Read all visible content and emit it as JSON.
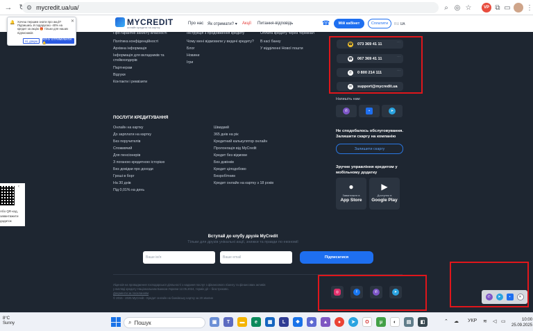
{
  "browser": {
    "url": "mycredit.ua/ua/"
  },
  "header": {
    "logo_name": "MYCREDIT",
    "logo_tagline": "онлайн кредити на картку",
    "nav": [
      "Про нас",
      "Як отримати? ▾",
      "Акції",
      "Питання-відповідь"
    ],
    "cabinet_button": "Мій кабінет",
    "pay_button": "Сплатити",
    "lang_ru": "RU",
    "lang_ua": "UA"
  },
  "popup": {
    "text": "Хочеш першим знати про акції? Підпишись й подаруємо -40% на кредит за акцію 🎁 тільки для наших підписників",
    "no_button": "Ні, дякую",
    "yes_button": "ХОЧУ ОТРИМУВАТИ 🔔"
  },
  "footer": {
    "col1": [
      "Про гарантію захисту власності",
      "Політика конфіденційності",
      "Архівна інформація",
      "Інформація для вкладників та стейкхолдерів",
      "Партнерам",
      "Відгуки",
      "Контакти і реквізити"
    ],
    "col2": [
      "Інструкція з продовження кредиту",
      "Чому мені відмовили у видачі кредиту?",
      "Блог",
      "Новини",
      "Ігри"
    ],
    "col3": [
      "Оплата кредиту через термінал",
      "В касі банку",
      "У відділенні Нової пошти"
    ],
    "services_title": "ПОСЛУГИ КРЕДИТУВАННЯ",
    "services_col1": [
      "Онлайн на картку",
      "До зарплати на картку",
      "Без поручителів",
      "Споживчий",
      "Для пенсіонерів",
      "З поганою кредитною історією",
      "Без довідки про доходи",
      "Гроші в борг",
      "На 30 днів",
      "Під 0,01% на день"
    ],
    "services_col2": [
      "Швидкий",
      "365 днів на рік",
      "Кредитний калькулятор онлайн",
      "Пролонгація від MyCredit",
      "Кредит без відмови",
      "Без дзвінків",
      "Кредит цілодобово",
      "Безробітним",
      "Кредит онлайн на картку з 18 років"
    ]
  },
  "contacts": {
    "phones": [
      "073 369 41 11",
      "067 369 41 11",
      "0 800 214 111"
    ],
    "email": "support@mycredit.ua",
    "write_us": "Напишіть нам:",
    "complaint_title": "Не сподобалось обслуговування. Залишити скаргу на компанію",
    "complaint_button": "Залишити скаргу",
    "app_title": "Зручне управління кредитом у мобільному додатку",
    "app_store_small": "Завантажте в",
    "app_store": "App Store",
    "google_small": "Доступно в",
    "google_play": "Google Play"
  },
  "subscribe": {
    "title": "Вступай до клубу друзів MyCredit",
    "subtitle": "Тільки для друзів унікальні акції, знижки та правди по економії",
    "name_placeholder": "Ваше ім'я",
    "email_placeholder": "Ваше email",
    "button": "Підписатися"
  },
  "legal": [
    "Ліцензія на провадження господарської діяльності з надання послуг з фінансового лізингу та фінансових активів",
    "у вигляді кредиту Національним Банком України 12.05.2024, термін дії – безстроково.",
    "Документи за посиланням",
    "© 2015 - 2025 MyCredit - Кредит онлайн на банківську картку за 20 хвилин"
  ],
  "qr_widget": {
    "line1": "Або QR-код,",
    "line2": "завантажити",
    "line3": "додаток"
  },
  "taskbar": {
    "temp": "8°C",
    "weather": "Sunny",
    "search": "Пошук",
    "lang": "УКР",
    "time": "10:00",
    "date": "25.09.2025"
  },
  "colors": {
    "page_bg": "#1e2631",
    "accent": "#1e6ff0",
    "highlight": "#e0161b"
  }
}
